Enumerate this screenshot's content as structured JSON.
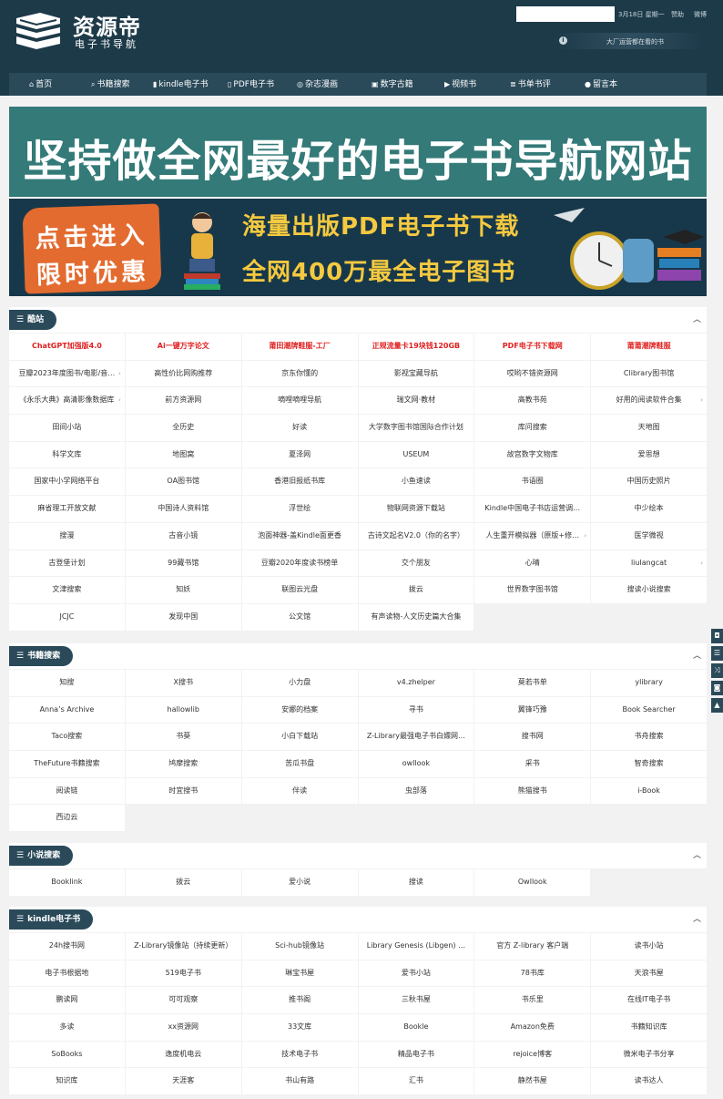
{
  "header": {
    "logo_title": "资源帝",
    "logo_sub": "电子书导航",
    "date": "3月18日 星期一",
    "sponsor": "赞助",
    "weibo": "微博",
    "notice_icon": "info-icon",
    "notice": "大厂运营都在看的书"
  },
  "nav": [
    {
      "icon": "home-icon",
      "glyph": "⌂",
      "label": "首页"
    },
    {
      "icon": "search-icon",
      "glyph": "⌕",
      "label": "书籍搜索"
    },
    {
      "icon": "book-icon",
      "glyph": "▮",
      "label": "kindle电子书"
    },
    {
      "icon": "file-icon",
      "glyph": "▯",
      "label": "PDF电子书"
    },
    {
      "icon": "globe-icon",
      "glyph": "◎",
      "label": "杂志漫画"
    },
    {
      "icon": "folder-icon",
      "glyph": "▣",
      "label": "数字古籍"
    },
    {
      "icon": "video-icon",
      "glyph": "▶",
      "label": "视频书"
    },
    {
      "icon": "list-icon",
      "glyph": "≣",
      "label": "书单书评"
    },
    {
      "icon": "comment-icon",
      "glyph": "●",
      "label": "留言本"
    }
  ],
  "banner1": "坚持做全网最好的电子书导航网站",
  "banner2": {
    "btn_line1": "点击进入",
    "btn_line2": "限时优惠",
    "promo1": "海量出版PDF电子书下载",
    "promo2": "全网400万最全电子图书"
  },
  "colors": {
    "header_bg": "#1d3a49",
    "nav_bg": "#2a4a5a",
    "banner_teal": "#337a78",
    "hot_red": "#e02020",
    "promo_yellow": "#f5c940",
    "btn_orange": "#e36b2f"
  },
  "sections": [
    {
      "title": "酷站",
      "hot": [
        "ChatGPT加强版4.0",
        "Ai一键万字论文",
        "莆田潮牌鞋服-工厂",
        "正规流量卡19块钱120GB",
        "PDF电子书下载网",
        "莆莆潮牌鞋服"
      ],
      "items": [
        "豆瓣2023年度图书/电影/音…",
        "高性价比网购推荐",
        "京东你懂的",
        "影视宝藏导航",
        "哎哟不错资源网",
        "Clibrary图书馆",
        "《永乐大典》高清影像数据库",
        "前方资源网",
        "嘀哩嘀哩导航",
        "瑞文网·教材",
        "高教书苑",
        "好用的阅读软件合集",
        "田间小站",
        "全历史",
        "好读",
        "大学数字图书馆国际合作计划",
        "库问搜索",
        "天地图",
        "科学文库",
        "地图窝",
        "夏泽网",
        "USEUM",
        "故宫数字文物库",
        "爱思想",
        "国家中小学网络平台",
        "OA图书馆",
        "香港旧报纸书库",
        "小鱼速读",
        "书语圈",
        "中国历史照片",
        "麻省理工开放文献",
        "中国诗人资料馆",
        "浮世绘",
        "物联网资源下载站",
        "Kindle中国电子书店运营调…",
        "中少绘本",
        "搜漫",
        "古音小镜",
        "泡面神器-盖Kindle面更香",
        "古诗文起名V2.0（你的名字）",
        "人生重开模拟器（原版+修…",
        "医学微视",
        "古登堡计划",
        "99藏书馆",
        "豆瓣2020年度读书榜单",
        "交个朋友",
        "心晴",
        "liulangcat",
        "文津搜索",
        "知妖",
        "联图云光盘",
        "拨云",
        "世界数字图书馆",
        "搜读小说搜索",
        "JCJC",
        "发现中国",
        "公文馆",
        "有声读物-人文历史篇大合集"
      ],
      "arrow_items": [
        0,
        6,
        11,
        40,
        47
      ]
    },
    {
      "title": "书籍搜索",
      "hot": [],
      "items": [
        "知搜",
        "X搜书",
        "小力盘",
        "v4.zhelper",
        "莫若书单",
        "ylibrary",
        "Anna’s Archive",
        "hallowlib",
        "安娜的档案",
        "寻书",
        "翼锋巧豫",
        "Book Searcher",
        "Taco搜索",
        "书葵",
        "小白下载站",
        "Z-Library最强电子书白嫖网…",
        "搜书网",
        "书舟搜索",
        "TheFuture书籍搜索",
        "鸠摩搜索",
        "苦瓜书盘",
        "owllook",
        "采书",
        "智奇搜索",
        "阅读链",
        "时宜搜书",
        "伴读",
        "虫部落",
        "熊猫搜书",
        "i-Book",
        "西边云"
      ],
      "arrow_items": []
    },
    {
      "title": "小说搜索",
      "hot": [],
      "items": [
        "Booklink",
        "拨云",
        "爱小说",
        "搜读",
        "Owllook"
      ],
      "arrow_items": []
    },
    {
      "title": "kindle电子书",
      "hot": [],
      "items": [
        "24h搜书网",
        "Z-Library镜像站（持续更新）",
        "Sci-hub镜像站",
        "Library Genesis (Libgen) …",
        "官方 Z-library 客户端",
        "读书小站",
        "电子书根据地",
        "519电子书",
        "琳宝书屋",
        "爱书小站",
        "78书库",
        "天浪书屋",
        "鹏读网",
        "可可观察",
        "推书阁",
        "三秋书屋",
        "书乐里",
        "在线IT电子书",
        "多读",
        "xx资源网",
        "33文库",
        "Bookle",
        "Amazon免费",
        "书籍知识库",
        "SoBooks",
        "逸度机电云",
        "技术电子书",
        "精品电子书",
        "rejoice博客",
        "微米电子书分享",
        "知识库",
        "天涯客",
        "书山有路",
        "汇书",
        "静然书屋",
        "读书达人"
      ],
      "arrow_items": []
    }
  ],
  "side_tools": [
    {
      "icon": "qq-icon",
      "glyph": "◘"
    },
    {
      "icon": "menu-icon",
      "glyph": "☰"
    },
    {
      "icon": "shuffle-icon",
      "glyph": "⤨"
    },
    {
      "icon": "wechat-icon",
      "glyph": "◙"
    },
    {
      "icon": "top-icon",
      "glyph": "▲"
    }
  ]
}
